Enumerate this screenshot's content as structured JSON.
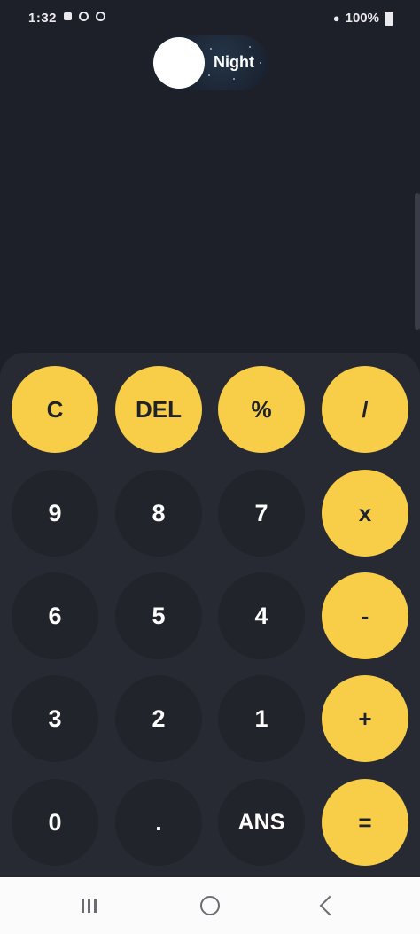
{
  "status_bar": {
    "time": "1:32",
    "battery": "100%",
    "icons": [
      "notification-dot-icon",
      "location-icon",
      "sync-icon",
      "wifi-icon",
      "battery-icon"
    ]
  },
  "theme_toggle": {
    "label": "Night",
    "state": "night"
  },
  "keypad": {
    "rows": [
      [
        "C",
        "DEL",
        "%",
        "/"
      ],
      [
        "9",
        "8",
        "7",
        "x"
      ],
      [
        "6",
        "5",
        "4",
        "-"
      ],
      [
        "3",
        "2",
        "1",
        "+"
      ],
      [
        "0",
        ".",
        "ANS",
        "="
      ]
    ]
  },
  "colors": {
    "background": "#1e2029",
    "keypad_panel": "#282a33",
    "accent_key": "#f8cd48",
    "digit_key": "#22242c",
    "nav_bar": "#fbfbfb"
  },
  "nav_bar": {
    "icons": [
      "recents-icon",
      "home-icon",
      "back-icon"
    ]
  }
}
